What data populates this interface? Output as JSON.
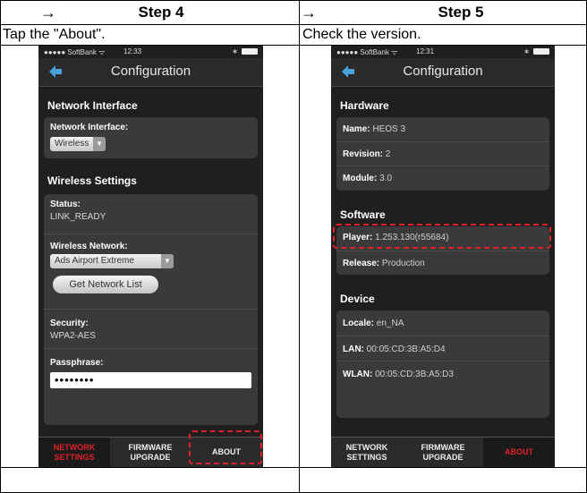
{
  "header": {
    "arrow_left": "→",
    "step_left": "Step 4",
    "arrow_right": "→",
    "step_right": "Step 5"
  },
  "instructions": {
    "left": "Tap the \"About\".",
    "right": "Check the version."
  },
  "phone_left": {
    "carrier": "●●●●● SoftBank ᯤ",
    "time": "12:33",
    "bt": "∗",
    "nav_title": "Configuration",
    "network_interface_section": "Network Interface",
    "network_interface_label": "Network Interface:",
    "network_interface_value": "Wireless",
    "wireless_section": "Wireless Settings",
    "status_label": "Status:",
    "status_value": "LINK_READY",
    "wireless_network_label": "Wireless Network:",
    "wireless_network_value": "Ads Airport Extreme",
    "get_list_button": "Get Network List",
    "security_label": "Security:",
    "security_value": "WPA2-AES",
    "passphrase_label": "Passphrase:",
    "passphrase_value": "••••••••",
    "tabs": [
      {
        "line1": "NETWORK",
        "line2": "SETTINGS"
      },
      {
        "line1": "FIRMWARE",
        "line2": "UPGRADE"
      },
      {
        "line1": "ABOUT",
        "line2": ""
      }
    ]
  },
  "phone_right": {
    "carrier": "●●●●● SoftBank ᯤ",
    "time": "12:31",
    "bt": "∗",
    "nav_title": "Configuration",
    "hardware_section": "Hardware",
    "name_label": "Name:",
    "name_value": "HEOS 3",
    "revision_label": "Revision:",
    "revision_value": "2",
    "module_label": "Module:",
    "module_value": "3.0",
    "software_section": "Software",
    "player_label": "Player:",
    "player_value": "1.253.130(r55684)",
    "release_label": "Release:",
    "release_value": "Production",
    "device_section": "Device",
    "locale_label": "Locale:",
    "locale_value": "en_NA",
    "lan_label": "LAN:",
    "lan_value": "00:05:CD:3B:A5:D4",
    "wlan_label": "WLAN:",
    "wlan_value": "00:05:CD:3B:A5:D3",
    "tabs": [
      {
        "line1": "NETWORK",
        "line2": "SETTINGS"
      },
      {
        "line1": "FIRMWARE",
        "line2": "UPGRADE"
      },
      {
        "line1": "ABOUT",
        "line2": ""
      }
    ]
  },
  "colors": {
    "highlight": "#e0202a",
    "screen_bg": "#1f1f1f"
  }
}
